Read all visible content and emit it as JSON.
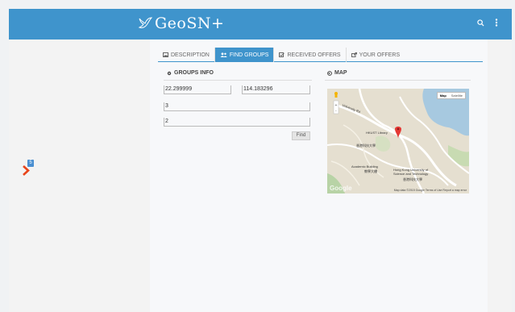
{
  "header": {
    "logo_text": "GeoSN+",
    "search_icon": "search-icon",
    "menu_icon": "more-vertical-icon"
  },
  "sidebar": {
    "badge": "5",
    "toggle_icon": "chevron-right-icon"
  },
  "tabs": [
    {
      "label": "Description",
      "icon": "image-icon",
      "active": false
    },
    {
      "label": "Find Groups",
      "icon": "users-icon",
      "active": true
    },
    {
      "label": "Received Offers",
      "icon": "check-square-icon",
      "active": false
    },
    {
      "label": "Your Offers",
      "icon": "share-icon",
      "active": false
    }
  ],
  "groups": {
    "title": "Groups Info",
    "lat": "22.299999",
    "lng": "114.183296",
    "field3": "3",
    "field4": "2",
    "find_label": "Find"
  },
  "map": {
    "title": "Map",
    "type_map": "Map",
    "type_satellite": "Satellite",
    "labels": {
      "library": "HKUST Library",
      "chinese1": "香港科技大學",
      "academic": "Academic Building",
      "academic_cn": "教學大樓",
      "hkust": "Hong Kong University of Science and Technology",
      "hkust_cn": "香港科技大學",
      "road": "University Rd"
    },
    "footer": "Map data ©2015 Google   Terms of Use   Report a map error",
    "google": "Google"
  },
  "colors": {
    "accent": "#3f94cc",
    "chevron": "#e8441a"
  }
}
